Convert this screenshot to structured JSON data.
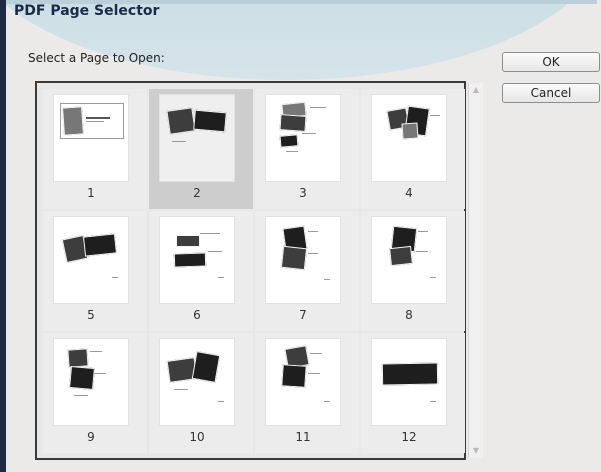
{
  "dialog": {
    "title": "PDF Page Selector",
    "prompt": "Select a Page to Open:",
    "ok_label": "OK",
    "cancel_label": "Cancel"
  },
  "pages": {
    "selected": "2",
    "items": [
      {
        "number": "1"
      },
      {
        "number": "2"
      },
      {
        "number": "3"
      },
      {
        "number": "4"
      },
      {
        "number": "5"
      },
      {
        "number": "6"
      },
      {
        "number": "7"
      },
      {
        "number": "8"
      },
      {
        "number": "9"
      },
      {
        "number": "10"
      },
      {
        "number": "11"
      },
      {
        "number": "12"
      }
    ]
  },
  "colors": {
    "title_text": "#1b2a48",
    "selected_cell": "#cdcdcd",
    "frame_border": "#3a3a3a"
  }
}
